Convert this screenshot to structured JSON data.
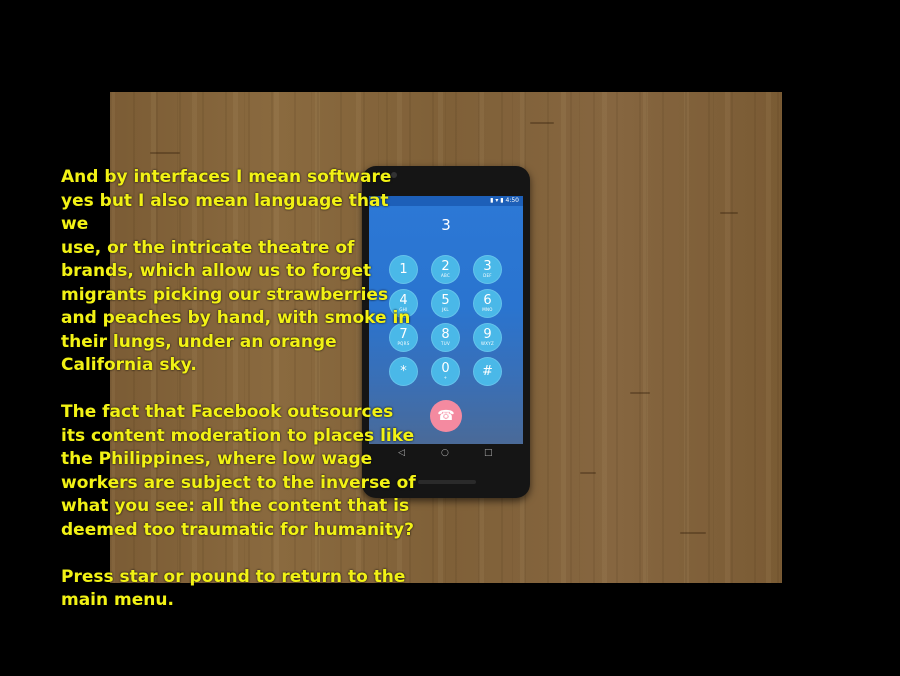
{
  "overlay": {
    "paragraph_1": "And by interfaces I mean software\nyes but I also mean language that we\nuse, or the intricate theatre of\nbrands, which allow us to forget\nmigrants picking our strawberries\nand peaches by hand, with smoke in\ntheir lungs, under an orange\nCalifornia sky.",
    "paragraph_2": "The fact that Facebook outsources\nits content moderation to places like\nthe Philippines, where low wage\nworkers are subject to the inverse of\nwhat you see: all the content that is\ndeemed too traumatic for humanity?",
    "paragraph_3": "Press star or pound to return to the\nmain menu."
  },
  "phone": {
    "status_time": "4:50",
    "dialed_number": "3",
    "keys": [
      {
        "digit": "1",
        "letters": ""
      },
      {
        "digit": "2",
        "letters": "ABC"
      },
      {
        "digit": "3",
        "letters": "DEF"
      },
      {
        "digit": "4",
        "letters": "GHI"
      },
      {
        "digit": "5",
        "letters": "JKL"
      },
      {
        "digit": "6",
        "letters": "MNO"
      },
      {
        "digit": "7",
        "letters": "PQRS"
      },
      {
        "digit": "8",
        "letters": "TUV"
      },
      {
        "digit": "9",
        "letters": "WXYZ"
      },
      {
        "digit": "*",
        "letters": ""
      },
      {
        "digit": "0",
        "letters": "+"
      },
      {
        "digit": "#",
        "letters": ""
      }
    ],
    "end_call_icon": "phone-hangup-icon",
    "nav_icons": [
      "back-icon",
      "home-icon",
      "recents-icon"
    ]
  },
  "colors": {
    "overlay_text": "#f2f215",
    "key_background": "#4ab8e8",
    "end_call": "#f48aa0",
    "screen": "#2c78d6"
  }
}
